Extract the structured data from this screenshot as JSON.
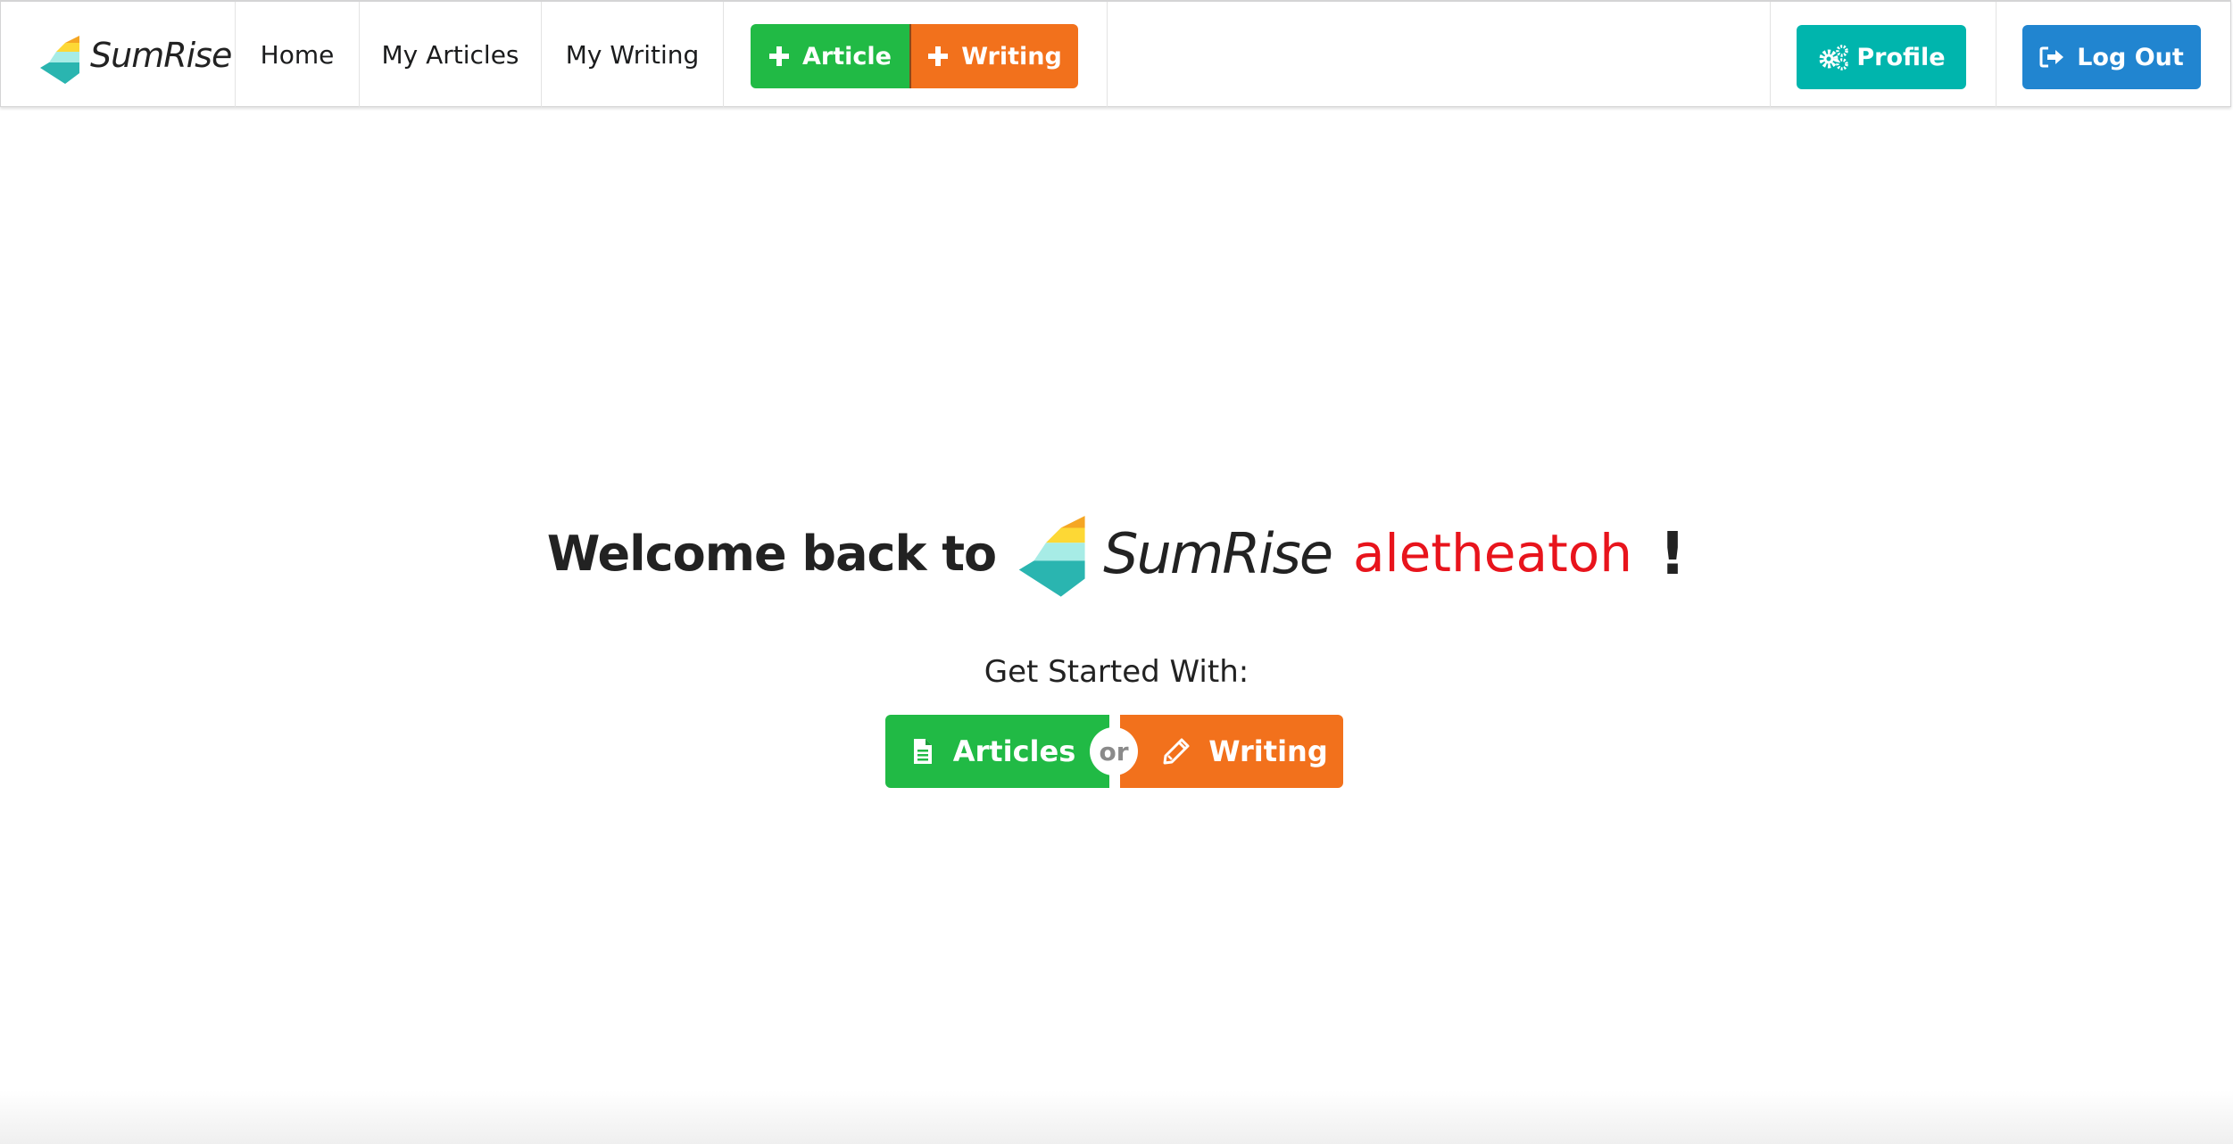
{
  "navbar": {
    "brand": "SumRise",
    "links": {
      "home": "Home",
      "my_articles": "My Articles",
      "my_writing": "My Writing"
    },
    "add_article_label": "Article",
    "add_writing_label": "Writing",
    "profile_label": "Profile",
    "logout_label": "Log Out"
  },
  "main": {
    "welcome_prefix": "Welcome back to",
    "brand": "SumRise",
    "username": "aletheatoh",
    "exclamation": "!",
    "get_started": "Get Started With:",
    "articles_label": "Articles",
    "or_label": "or",
    "writing_label": "Writing"
  },
  "colors": {
    "green": "#21ba45",
    "orange": "#f2711c",
    "teal": "#00b5ad",
    "blue": "#2185d0",
    "username_red": "#e8141c"
  },
  "icons": {
    "add_article": "plus-icon",
    "add_writing": "plus-icon",
    "profile": "gears-icon",
    "logout": "sign-out-icon",
    "articles": "file-icon",
    "writing": "pencil-icon"
  }
}
